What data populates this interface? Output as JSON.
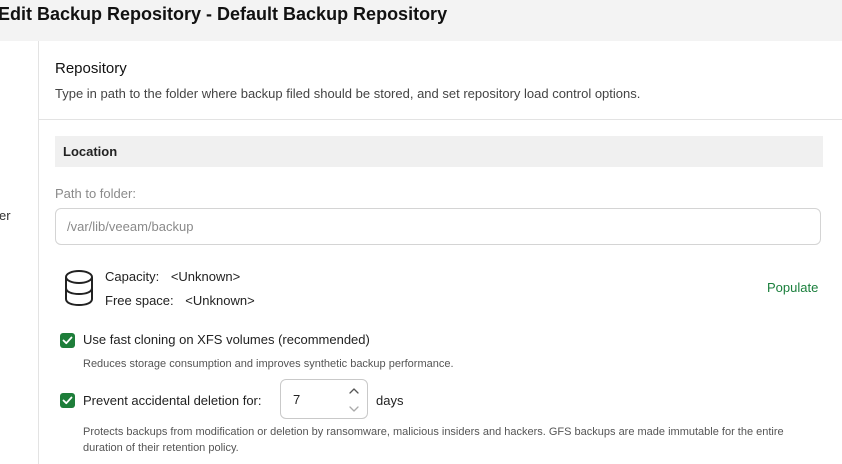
{
  "window": {
    "title": "Edit Backup Repository - Default Backup Repository",
    "left_pane_fragment": "er"
  },
  "header": {
    "title": "Repository",
    "description": "Type in path to the folder where backup filed should be stored, and set repository load control options."
  },
  "location": {
    "section_label": "Location",
    "path_label": "Path to folder:",
    "path_value": "",
    "path_placeholder": "/var/lib/veeam/backup",
    "capacity_label": "Capacity:",
    "capacity_value": "<Unknown>",
    "free_space_label": "Free space:",
    "free_space_value": "<Unknown>",
    "populate_label": "Populate",
    "storage_icon": "database-icon"
  },
  "options": {
    "fast_cloning": {
      "checked": true,
      "label": "Use fast cloning on XFS volumes (recommended)",
      "help": "Reduces storage consumption and improves synthetic backup performance."
    },
    "prevent_deletion": {
      "checked": true,
      "label": "Prevent accidental deletion for:",
      "days_value": "7",
      "days_unit": "days",
      "help": "Protects backups from modification or deletion by ransomware, malicious insiders and hackers. GFS backups are made immutable for the entire duration of their retention policy."
    }
  },
  "colors": {
    "accent": "#1e7e3a",
    "link": "#1a7f3c",
    "titlebar_bg": "#f3f3f3",
    "section_bar_bg": "#f0f0f0"
  }
}
